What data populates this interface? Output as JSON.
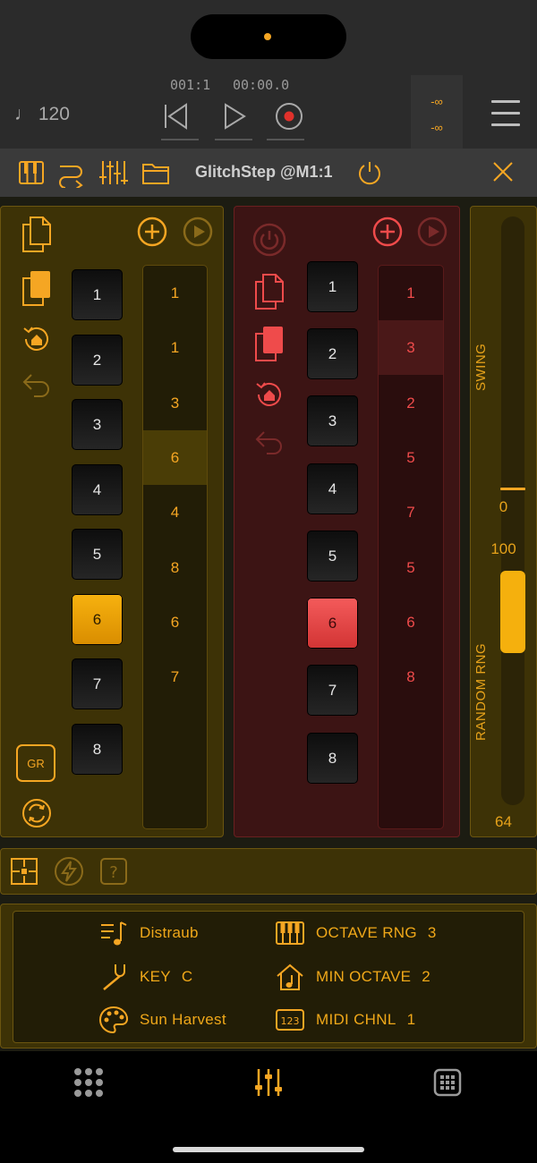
{
  "transport": {
    "tempo": "♩ 120",
    "bar_position": "001:1",
    "time_position": "00:00.0",
    "meter_top": "-∞",
    "meter_bottom": "-∞"
  },
  "plugin_header": {
    "title": "GlitchStep @M1:1"
  },
  "left_panel": {
    "steps": [
      "1",
      "2",
      "3",
      "4",
      "5",
      "6",
      "7",
      "8"
    ],
    "active_step": "6",
    "sequence": [
      "1",
      "1",
      "3",
      "6",
      "4",
      "8",
      "6",
      "7"
    ],
    "highlighted_index": 3,
    "gr_label": "GR"
  },
  "right_panel": {
    "steps": [
      "1",
      "2",
      "3",
      "4",
      "5",
      "6",
      "7",
      "8"
    ],
    "active_step": "6",
    "sequence": [
      "1",
      "3",
      "2",
      "5",
      "7",
      "5",
      "6",
      "8"
    ],
    "highlighted_index": 1
  },
  "side_panel": {
    "swing_label": "SWING",
    "swing_value": "0",
    "random_label": "RANDOM RNG",
    "random_value_top": "100",
    "random_value_bottom": "64"
  },
  "info": {
    "pattern_name": "Distraub",
    "key_label": "KEY",
    "key_value": "C",
    "scale_name": "Sun Harvest",
    "octave_rng_label": "OCTAVE RNG",
    "octave_rng_value": "3",
    "min_octave_label": "MIN OCTAVE",
    "min_octave_value": "2",
    "midi_chnl_label": "MIDI CHNL",
    "midi_chnl_value": "1"
  },
  "colors": {
    "accent_orange": "#f5a623",
    "accent_red": "#ef4b4b",
    "panel_yellow": "#3d3206",
    "panel_red": "#3c1414"
  },
  "icons": {
    "tabbar": [
      "grid-dots-icon",
      "mixer-sliders-icon",
      "keypad-icon"
    ]
  }
}
